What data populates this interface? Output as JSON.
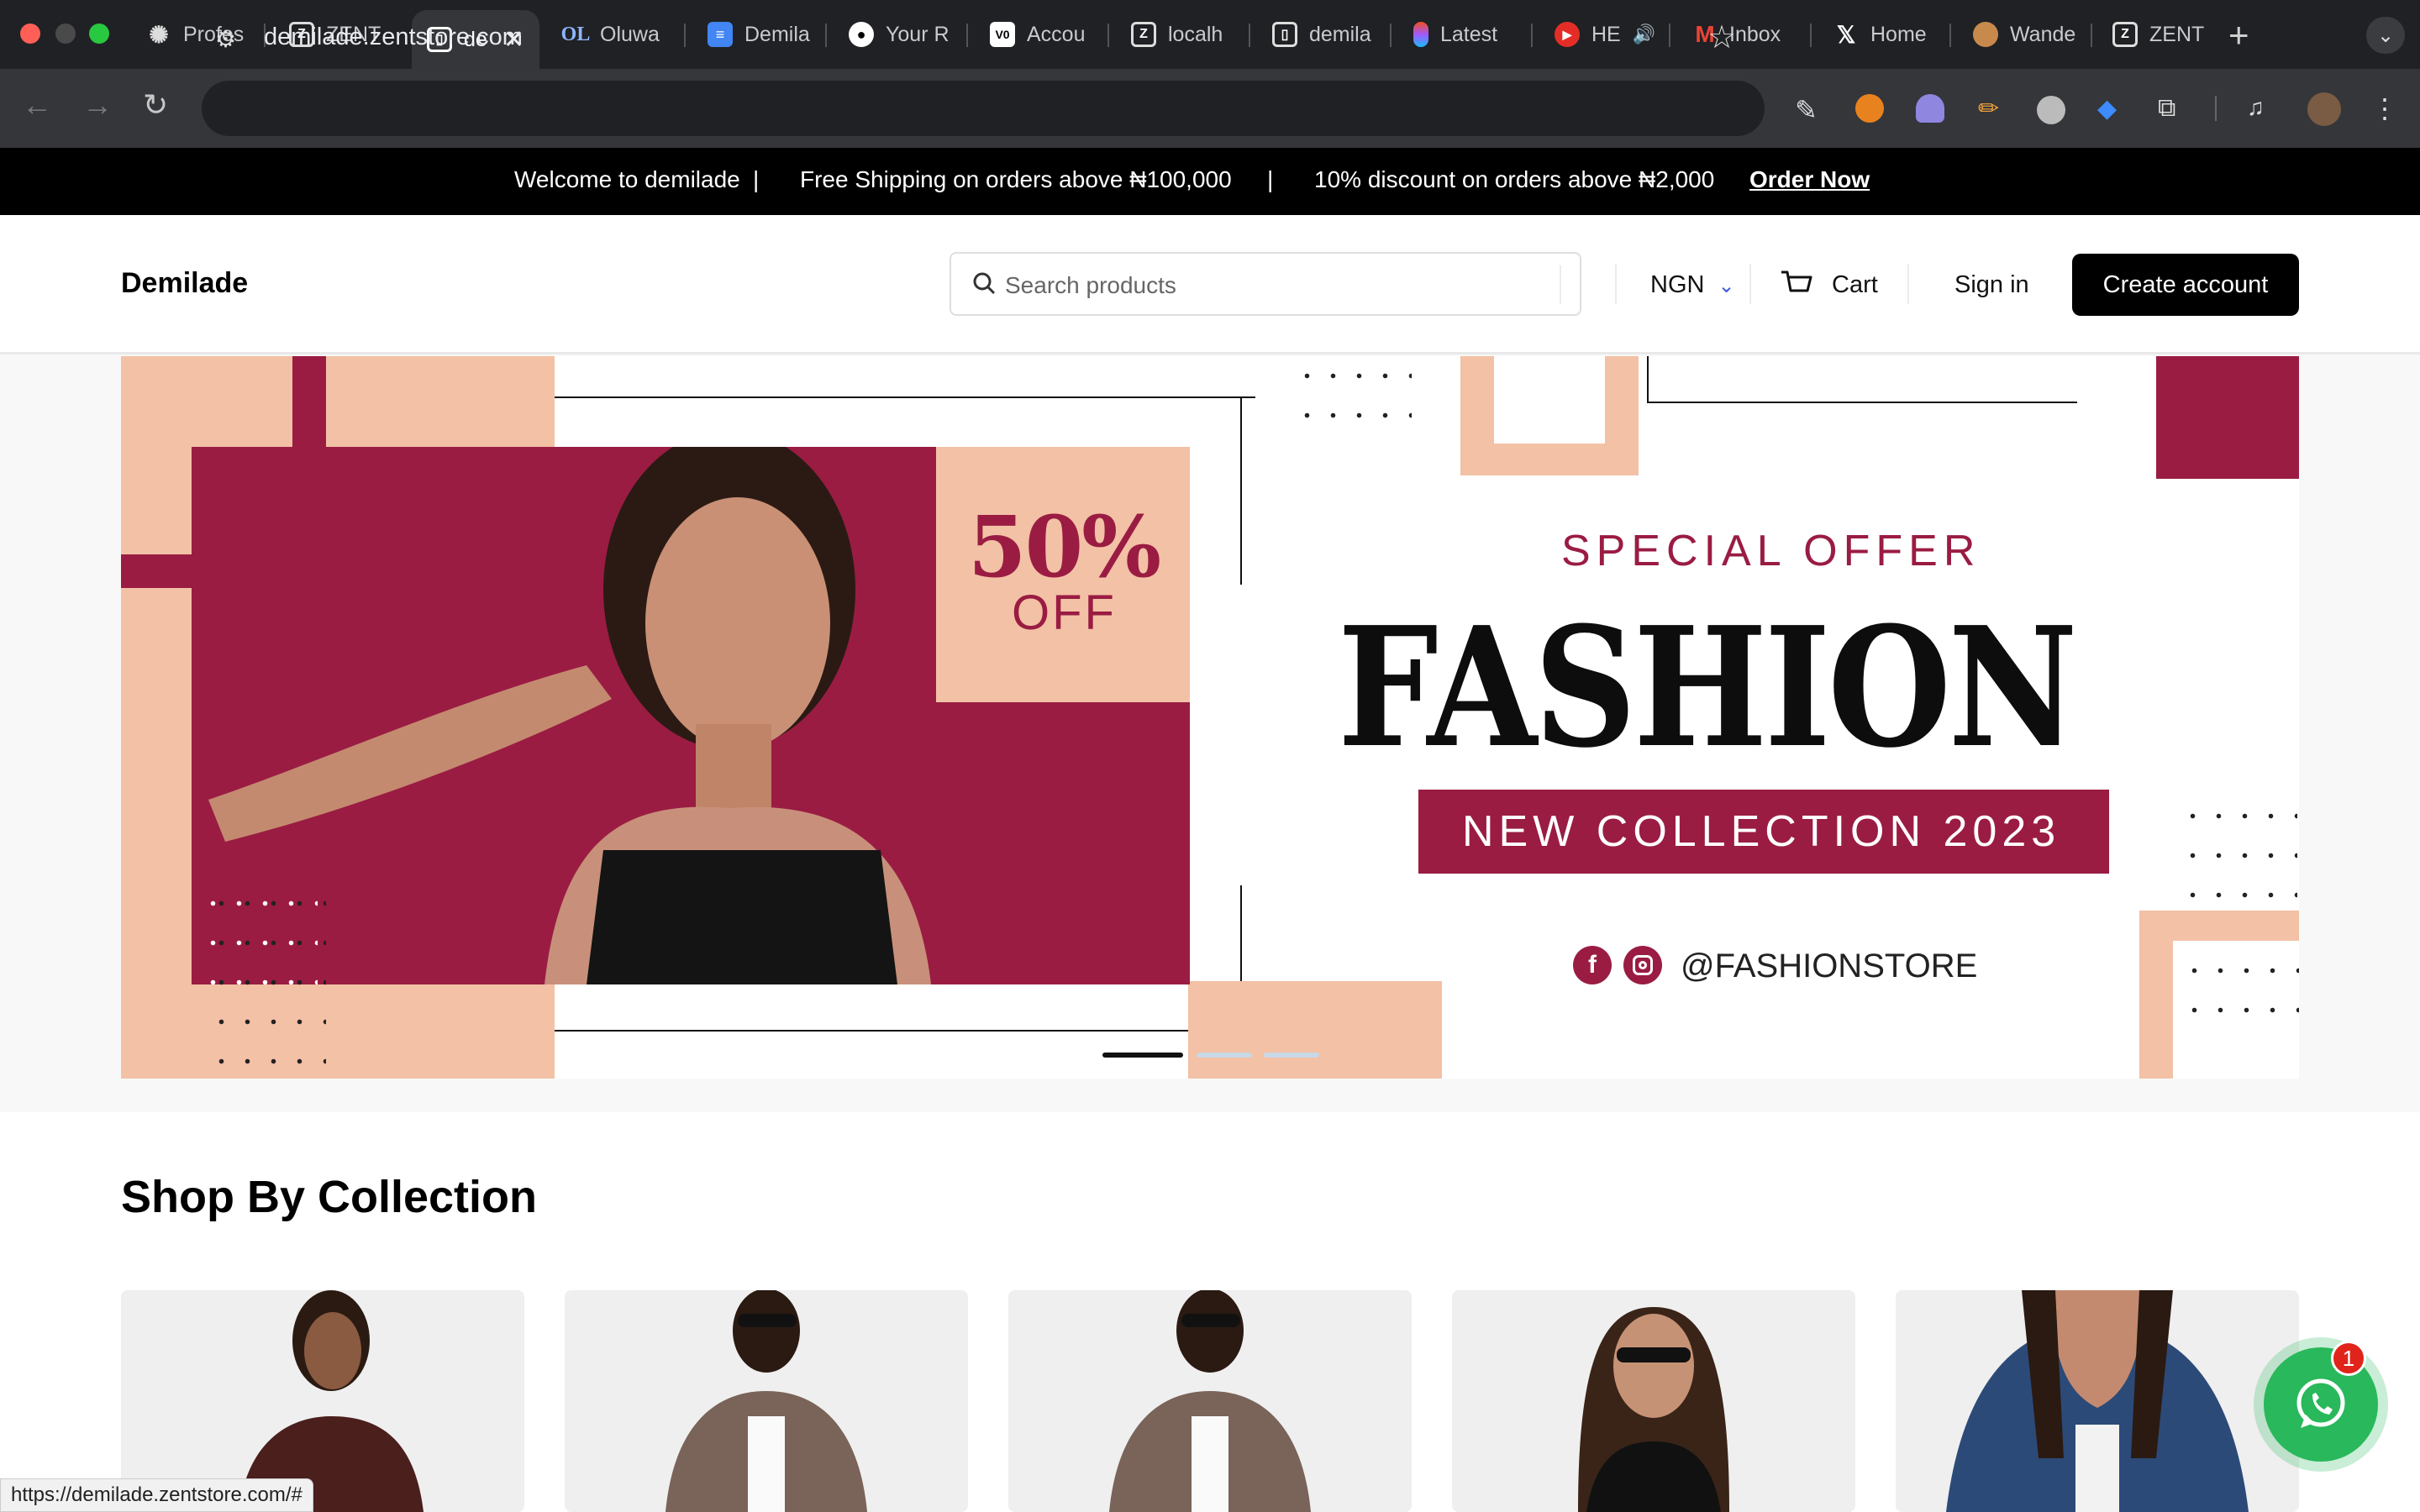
{
  "browser": {
    "tabs": [
      {
        "label": "Profes",
        "icon": "openai-icon"
      },
      {
        "label": "ZENT",
        "icon": "zent-icon"
      },
      {
        "label": "de",
        "icon": "demilade-icon",
        "active": true
      },
      {
        "label": "Oluwa",
        "icon": "ol-icon"
      },
      {
        "label": "Demila",
        "icon": "docs-icon"
      },
      {
        "label": "Your R",
        "icon": "github-icon"
      },
      {
        "label": "Accou",
        "icon": "vercel-icon"
      },
      {
        "label": "localh",
        "icon": "zent-icon"
      },
      {
        "label": "demila",
        "icon": "demilade-icon"
      },
      {
        "label": "Latest",
        "icon": "figma-icon"
      },
      {
        "label": "HE",
        "icon": "youtube-icon"
      },
      {
        "label": "Inbox",
        "icon": "gmail-icon"
      },
      {
        "label": "Home",
        "icon": "x-icon"
      },
      {
        "label": "Wande",
        "icon": "monkey-icon"
      },
      {
        "label": "ZENT",
        "icon": "zent-icon"
      }
    ],
    "ol_glyph": "OL",
    "url": "demilade.zentstore.com",
    "new_tab": "+",
    "status_url": "https://demilade.zentstore.com/#"
  },
  "announcement": {
    "welcome": "Welcome to demilade",
    "sep1": "|",
    "shipping": "Free Shipping on orders above ₦100,000",
    "sep2": "|",
    "discount": "10% discount on orders above ₦2,000",
    "cta": "Order Now"
  },
  "header": {
    "logo": "Demilade",
    "search_placeholder": "Search products",
    "currency": "NGN",
    "cart": "Cart",
    "sign_in": "Sign in",
    "create_account": "Create account"
  },
  "hero": {
    "discount_big": "50%",
    "discount_off": "OFF",
    "eyebrow": "SPECIAL OFFER",
    "headline": "FASHION",
    "collection": "NEW COLLECTION 2023",
    "handle": "@FASHIONSTORE",
    "slides": 3,
    "active_slide": 1,
    "colors": {
      "maroon": "#9a1c43",
      "peach": "#f3c1a5"
    }
  },
  "collection": {
    "title": "Shop By Collection"
  },
  "chat": {
    "badge": "1",
    "accent": "#29b85b"
  }
}
